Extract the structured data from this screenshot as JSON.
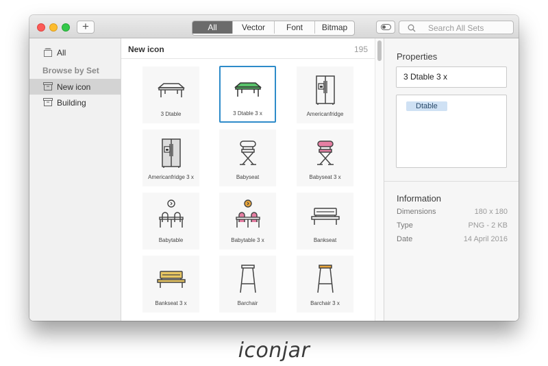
{
  "toolbar": {
    "add_label": "+",
    "filters": [
      {
        "label": "All",
        "active": true
      },
      {
        "label": "Vector",
        "active": false
      },
      {
        "label": "Font",
        "active": false
      },
      {
        "label": "Bitmap",
        "active": false
      }
    ],
    "search_placeholder": "Search All Sets"
  },
  "sidebar": {
    "all_label": "All",
    "heading": "Browse by Set",
    "sets": [
      {
        "label": "New icon",
        "selected": true
      },
      {
        "label": "Building",
        "selected": false
      }
    ]
  },
  "main": {
    "title": "New icon",
    "count": "195",
    "icons": [
      {
        "label": "3 Dtable",
        "icon": "table-outline-icon",
        "selected": false
      },
      {
        "label": "3 Dtable 3 x",
        "icon": "table-green-icon",
        "selected": true
      },
      {
        "label": "Americanfridge",
        "icon": "fridge-outline-icon",
        "selected": false
      },
      {
        "label": "Americanfridge 3 x",
        "icon": "fridge-gray-icon",
        "selected": false
      },
      {
        "label": "Babyseat",
        "icon": "babyseat-outline-icon",
        "selected": false
      },
      {
        "label": "Babyseat 3 x",
        "icon": "babyseat-pink-icon",
        "selected": false
      },
      {
        "label": "Babytable",
        "icon": "babytable-outline-icon",
        "selected": false
      },
      {
        "label": "Babytable 3 x",
        "icon": "babytable-color-icon",
        "selected": false
      },
      {
        "label": "Bankseat",
        "icon": "bench-outline-icon",
        "selected": false
      },
      {
        "label": "Bankseat 3 x",
        "icon": "bench-yellow-icon",
        "selected": false
      },
      {
        "label": "Barchair",
        "icon": "barchair-outline-icon",
        "selected": false
      },
      {
        "label": "Barchair 3 x",
        "icon": "barchair-color-icon",
        "selected": false
      }
    ]
  },
  "properties": {
    "heading": "Properties",
    "name_value": "3 Dtable 3 x",
    "tags": [
      "Dtable"
    ]
  },
  "information": {
    "heading": "Information",
    "rows": [
      {
        "key": "Dimensions",
        "value": "180 x 180"
      },
      {
        "key": "Type",
        "value": "PNG - 2 KB"
      },
      {
        "key": "Date",
        "value": "14 April 2016"
      }
    ]
  },
  "colors": {
    "accent": "#2d8bc9",
    "table_green": "#59c36a",
    "seat_pink": "#e67fa3",
    "bench_yellow": "#e9c762",
    "fridge_gray": "#dcdcdc"
  },
  "caption": "iconjar"
}
